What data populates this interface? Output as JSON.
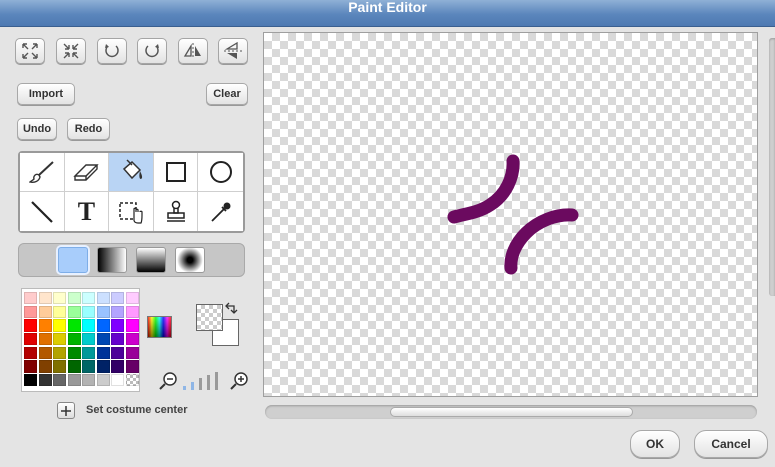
{
  "window": {
    "title": "Paint Editor"
  },
  "toolbar_icons": [
    "zoom-in-arrows-icon",
    "zoom-out-arrows-icon",
    "rotate-left-icon",
    "rotate-right-icon",
    "flip-horizontal-icon",
    "flip-vertical-icon"
  ],
  "buttons": {
    "import": "Import",
    "clear": "Clear",
    "undo": "Undo",
    "redo": "Redo",
    "ok": "OK",
    "cancel": "Cancel"
  },
  "tools": [
    {
      "name": "paintbrush-icon",
      "selected": false
    },
    {
      "name": "eraser-icon",
      "selected": false
    },
    {
      "name": "paint-bucket-icon",
      "selected": true
    },
    {
      "name": "rectangle-icon",
      "selected": false
    },
    {
      "name": "ellipse-icon",
      "selected": false
    },
    {
      "name": "line-icon",
      "selected": false
    },
    {
      "name": "text-icon",
      "selected": false
    },
    {
      "name": "select-icon",
      "selected": false
    },
    {
      "name": "stamp-icon",
      "selected": false
    },
    {
      "name": "eyedropper-icon",
      "selected": false
    }
  ],
  "text_tool_glyph": "T",
  "fill_modes": [
    "solid",
    "horizontal-gradient",
    "vertical-gradient",
    "radial-gradient"
  ],
  "selected_fill_mode": "solid",
  "palette": [
    "#ffcccc",
    "#ffe5cc",
    "#ffffcc",
    "#ccffcc",
    "#ccffff",
    "#cce0ff",
    "#ccccff",
    "#ffccff",
    "#ff9999",
    "#ffcc99",
    "#ffff99",
    "#99ff99",
    "#99ffff",
    "#99c2ff",
    "#b3a3ff",
    "#ff99ff",
    "#ff0000",
    "#ff8000",
    "#ffff00",
    "#00e600",
    "#00ffff",
    "#0066ff",
    "#8000ff",
    "#ff00ff",
    "#e00000",
    "#e07000",
    "#dccc00",
    "#00b300",
    "#00cccc",
    "#0047b3",
    "#6600cc",
    "#cc00cc",
    "#b30000",
    "#b35900",
    "#b3a300",
    "#008a00",
    "#009999",
    "#003399",
    "#4d0099",
    "#990099",
    "#800000",
    "#804000",
    "#807000",
    "#006600",
    "#006666",
    "#002266",
    "#330066",
    "#660066",
    "#000000",
    "#333333",
    "#666666",
    "#999999",
    "#b3b3b3",
    "#cccccc",
    "#ffffff",
    "transparent"
  ],
  "colors": {
    "stroke": "#6b0a5f",
    "primary": "#ffffff",
    "secondary": "#ffffff",
    "title_bar": "#5b86bc"
  },
  "brush_sizes": [
    1,
    2,
    3,
    4,
    5
  ],
  "set_center_label": "Set costume center"
}
